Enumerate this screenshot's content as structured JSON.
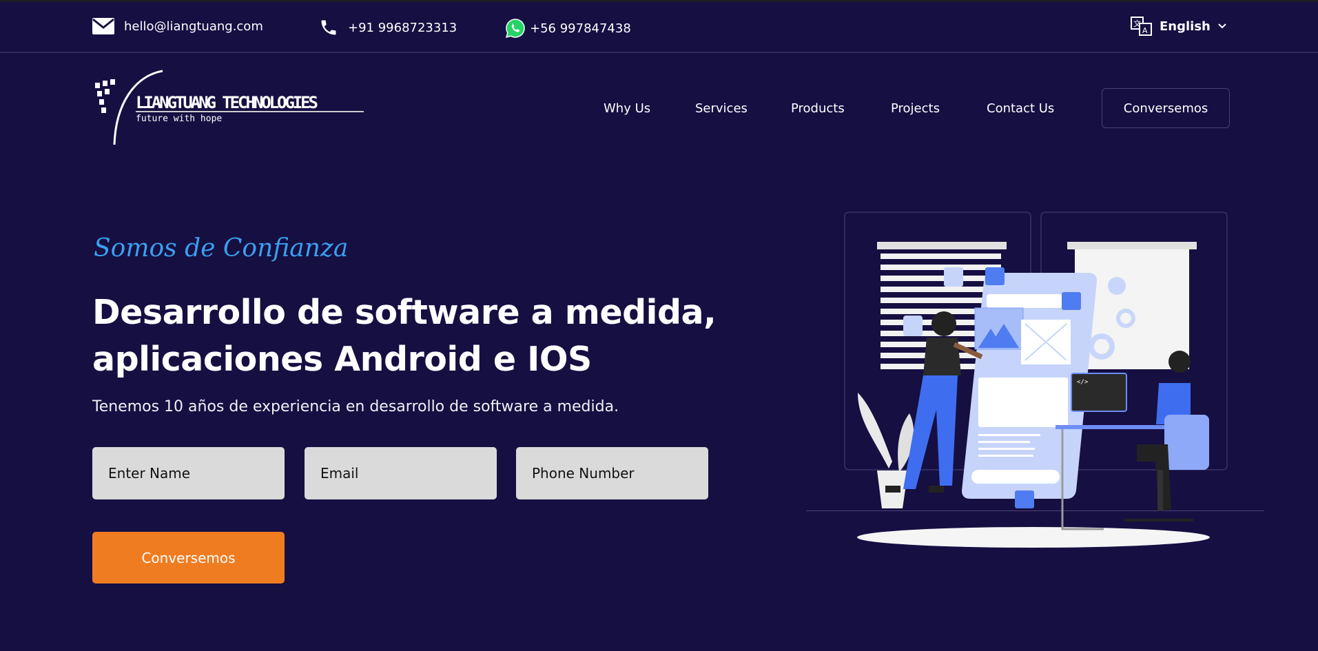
{
  "topbar": {
    "email": "hello@liangtuang.com",
    "phone": "+91 9968723313",
    "whatsapp": "+56 997847438",
    "language": "English"
  },
  "logo": {
    "name": "LIANGTUANG TECHNOLOGIES",
    "slogan": "future with hope"
  },
  "nav": {
    "items": [
      "Why Us",
      "Services",
      "Products",
      "Projects",
      "Contact Us"
    ],
    "cta": "Conversemos"
  },
  "hero": {
    "tagline": "Somos de Confianza",
    "title_line1": "Desarrollo de software a medida,",
    "title_line2": "aplicaciones Android e IOS",
    "subtitle": "Tenemos 10 años de experiencia en desarrollo de software a medida.",
    "form": {
      "name_placeholder": "Enter Name",
      "email_placeholder": "Email",
      "phone_placeholder": "Phone Number",
      "submit": "Conversemos"
    }
  },
  "colors": {
    "background": "#160f42",
    "accent_orange": "#f07c22",
    "accent_blue": "#3aa0f0",
    "whatsapp_green": "#25d366"
  }
}
